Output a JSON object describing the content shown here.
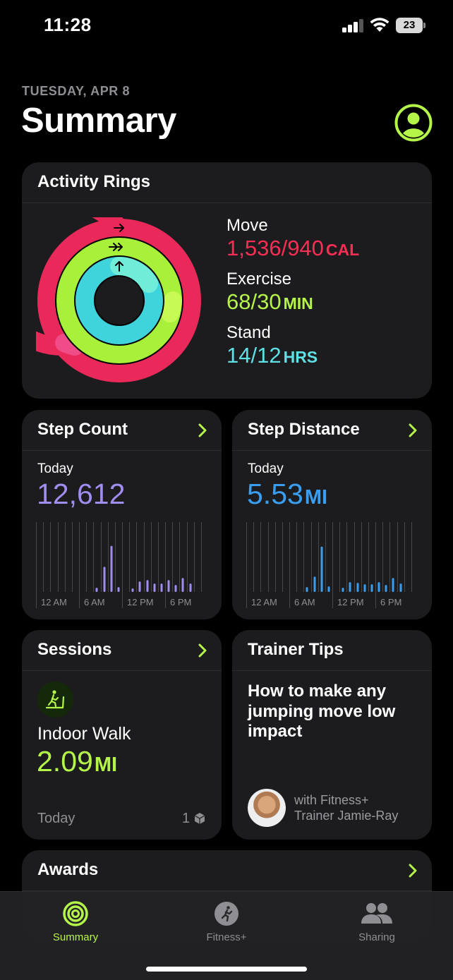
{
  "status_bar": {
    "time": "11:28",
    "battery": "23"
  },
  "header": {
    "date": "TUESDAY, APR 8",
    "title": "Summary"
  },
  "colors": {
    "move": "#fa2d55",
    "exercise": "#b5f54a",
    "stand": "#5fe0e5",
    "steps": "#a18cf0",
    "distance": "#3a9ef0",
    "accent": "#b5f54a"
  },
  "activity_rings": {
    "title": "Activity Rings",
    "move": {
      "label": "Move",
      "value": "1,536/940",
      "unit": "CAL",
      "progress": 1.634
    },
    "exercise": {
      "label": "Exercise",
      "value": "68/30",
      "unit": "MIN",
      "progress": 2.267
    },
    "stand": {
      "label": "Stand",
      "value": "14/12",
      "unit": "HRS",
      "progress": 1.167
    }
  },
  "step_count": {
    "title": "Step Count",
    "period": "Today",
    "value": "12,612",
    "x_labels": [
      "12 AM",
      "6 AM",
      "12 PM",
      "6 PM"
    ],
    "hourly": [
      0,
      0,
      0,
      0,
      0,
      0,
      0,
      0,
      0.06,
      0.36,
      0.66,
      0.07,
      0,
      0.05,
      0.15,
      0.17,
      0.12,
      0.12,
      0.17,
      0.1,
      0.2,
      0.12,
      0,
      0
    ]
  },
  "step_distance": {
    "title": "Step Distance",
    "period": "Today",
    "value": "5.53",
    "unit": "MI",
    "x_labels": [
      "12 AM",
      "6 AM",
      "12 PM",
      "6 PM"
    ],
    "hourly": [
      0,
      0,
      0,
      0,
      0,
      0,
      0,
      0,
      0.07,
      0.22,
      0.65,
      0.08,
      0,
      0.06,
      0.14,
      0.13,
      0.11,
      0.11,
      0.14,
      0.1,
      0.2,
      0.12,
      0,
      0
    ]
  },
  "sessions": {
    "title": "Sessions",
    "workout": "Indoor Walk",
    "value": "2.09",
    "unit": "MI",
    "day": "Today",
    "count": "1"
  },
  "trainer_tips": {
    "title": "Trainer Tips",
    "headline": "How to make any jumping move low impact",
    "trainer_line1": "with Fitness+",
    "trainer_line2": "Trainer Jamie-Ray"
  },
  "awards": {
    "title": "Awards"
  },
  "tabs": [
    {
      "label": "Summary",
      "icon": "activity-rings-icon",
      "selected": true
    },
    {
      "label": "Fitness+",
      "icon": "runner-icon",
      "selected": false
    },
    {
      "label": "Sharing",
      "icon": "people-icon",
      "selected": false
    }
  ]
}
